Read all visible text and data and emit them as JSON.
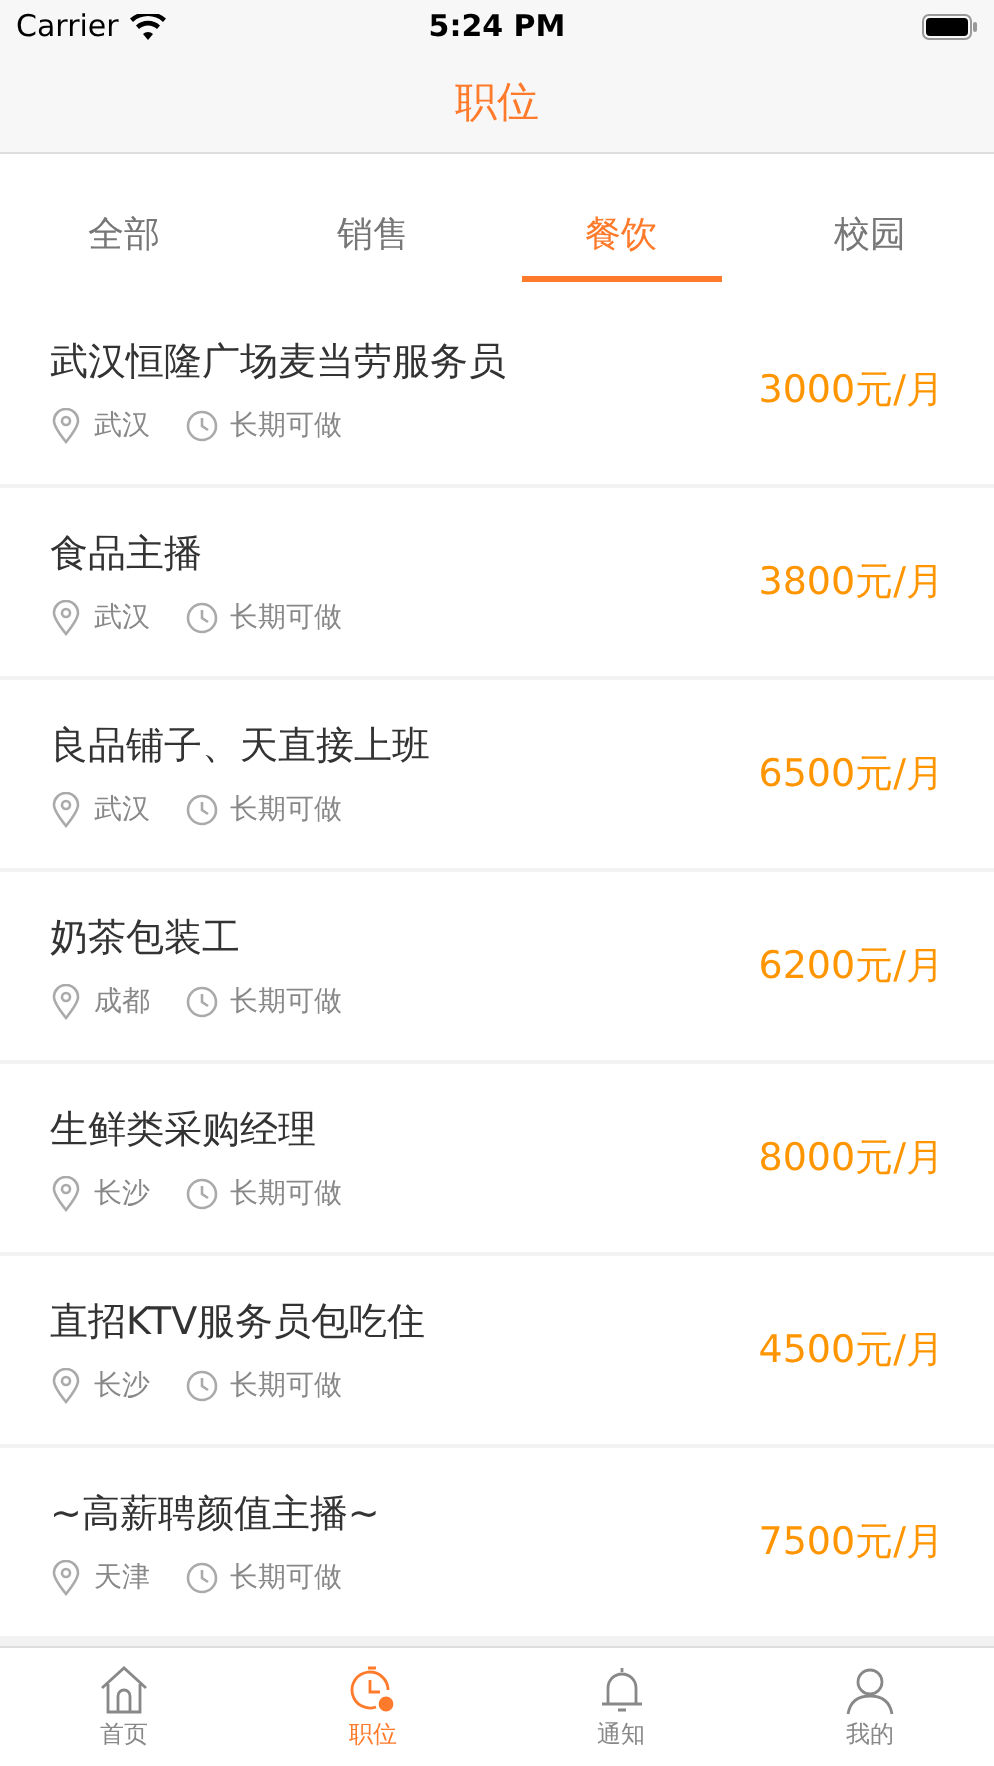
{
  "status_bar": {
    "carrier": "Carrier",
    "time": "5:24 PM"
  },
  "nav": {
    "title": "职位"
  },
  "tabs": [
    {
      "label": "全部",
      "selected": false
    },
    {
      "label": "销售",
      "selected": false
    },
    {
      "label": "餐饮",
      "selected": true
    },
    {
      "label": "校园",
      "selected": false
    }
  ],
  "jobs": [
    {
      "title": "武汉恒隆广场麦当劳服务员",
      "city": "武汉",
      "term": "长期可做",
      "salary": "3000元/月"
    },
    {
      "title": "食品主播",
      "city": "武汉",
      "term": "长期可做",
      "salary": "3800元/月"
    },
    {
      "title": "良品铺子、天直接上班",
      "city": "武汉",
      "term": "长期可做",
      "salary": "6500元/月"
    },
    {
      "title": "奶茶包装工",
      "city": "成都",
      "term": "长期可做",
      "salary": "6200元/月"
    },
    {
      "title": "生鲜类采购经理",
      "city": "长沙",
      "term": "长期可做",
      "salary": "8000元/月"
    },
    {
      "title": "直招KTV服务员包吃住",
      "city": "长沙",
      "term": "长期可做",
      "salary": "4500元/月"
    },
    {
      "title": "~高薪聘颜值主播~",
      "city": "天津",
      "term": "长期可做",
      "salary": "7500元/月"
    }
  ],
  "tab_bar": [
    {
      "kind": "home",
      "label": "首页",
      "selected": false
    },
    {
      "kind": "jobs",
      "label": "职位",
      "selected": true
    },
    {
      "kind": "notice",
      "label": "通知",
      "selected": false
    },
    {
      "kind": "me",
      "label": "我的",
      "selected": false
    }
  ]
}
